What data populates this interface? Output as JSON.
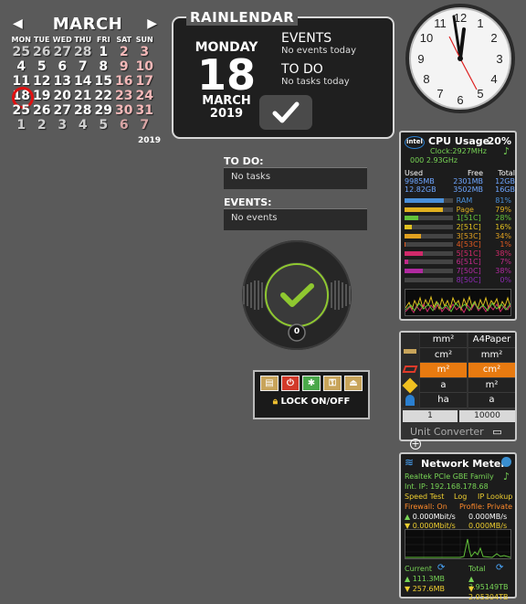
{
  "calendar": {
    "month": "MARCH",
    "year": "2019",
    "dow": [
      "MON",
      "TUE",
      "WED",
      "THU",
      "FRI",
      "SAT",
      "SUN"
    ],
    "days": [
      [
        "25",
        "dim"
      ],
      [
        "26",
        "dim"
      ],
      [
        "27",
        "dim"
      ],
      [
        "28",
        "dim"
      ],
      [
        "1",
        ""
      ],
      [
        "2",
        "wk"
      ],
      [
        "3",
        "wk"
      ],
      [
        "4",
        ""
      ],
      [
        "5",
        ""
      ],
      [
        "6",
        ""
      ],
      [
        "7",
        ""
      ],
      [
        "8",
        ""
      ],
      [
        "9",
        "wk"
      ],
      [
        "10",
        "wk"
      ],
      [
        "11",
        ""
      ],
      [
        "12",
        ""
      ],
      [
        "13",
        ""
      ],
      [
        "14",
        ""
      ],
      [
        "15",
        ""
      ],
      [
        "16",
        "wk"
      ],
      [
        "17",
        "wk"
      ],
      [
        "18",
        "today"
      ],
      [
        "19",
        ""
      ],
      [
        "20",
        ""
      ],
      [
        "21",
        ""
      ],
      [
        "22",
        ""
      ],
      [
        "23",
        "wk"
      ],
      [
        "24",
        "wk"
      ],
      [
        "25",
        ""
      ],
      [
        "26",
        ""
      ],
      [
        "27",
        ""
      ],
      [
        "28",
        ""
      ],
      [
        "29",
        ""
      ],
      [
        "30",
        "wk"
      ],
      [
        "31",
        "wk"
      ],
      [
        "1",
        "dim"
      ],
      [
        "2",
        "dim"
      ],
      [
        "3",
        "dim"
      ],
      [
        "4",
        "dim"
      ],
      [
        "5",
        "dim"
      ],
      [
        "6",
        "wkdim"
      ],
      [
        "7",
        "wkdim"
      ]
    ]
  },
  "rainlendar": {
    "title": "RAINLENDAR",
    "weekday": "MONDAY",
    "day": "18",
    "month": "MARCH",
    "year": "2019",
    "events_head": "EVENTS",
    "events_text": "No events today",
    "todo_head": "TO DO",
    "todo_text": "No tasks today"
  },
  "todo_panel": {
    "heading": "TO DO:",
    "text": "No tasks"
  },
  "events_panel": {
    "heading": "EVENTS:",
    "text": "No events"
  },
  "round_widget": {
    "count": "0"
  },
  "lock_widget": {
    "label": "LOCK ON/OFF"
  },
  "cpu": {
    "title": "CPU Usage",
    "percent": "20%",
    "clock": "Clock:2927MHz",
    "clock2": "000 2.93GHz",
    "headers": [
      "Used",
      "Free",
      "Total"
    ],
    "row1": [
      "9985MB",
      "2301MB",
      "12GB"
    ],
    "row2": [
      "12.82GB",
      "3502MB",
      "16GB"
    ],
    "bars": [
      {
        "label": "RAM",
        "value": "81%",
        "pct": 81,
        "color": "#4a8fd8"
      },
      {
        "label": "Page",
        "value": "79%",
        "pct": 79,
        "color": "#e0b020"
      },
      {
        "label": "1[51C]",
        "value": "28%",
        "pct": 28,
        "color": "#62c23a"
      },
      {
        "label": "2[51C]",
        "value": "16%",
        "pct": 16,
        "color": "#e0c020"
      },
      {
        "label": "3[53C]",
        "value": "34%",
        "pct": 34,
        "color": "#e0a020"
      },
      {
        "label": "4[53C]",
        "value": "1%",
        "pct": 1,
        "color": "#e05a20"
      },
      {
        "label": "5[51C]",
        "value": "38%",
        "pct": 38,
        "color": "#d02a6a"
      },
      {
        "label": "6[51C]",
        "value": "7%",
        "pct": 7,
        "color": "#c02a8a"
      },
      {
        "label": "7[50C]",
        "value": "38%",
        "pct": 38,
        "color": "#b02aa0"
      },
      {
        "label": "8[50C]",
        "value": "0%",
        "pct": 0,
        "color": "#8a2ab0"
      }
    ]
  },
  "unit_converter": {
    "left_col": [
      "mm²",
      "cm²",
      "m²",
      "a",
      "ha"
    ],
    "right_col": [
      "A4Paper",
      "mm²",
      "cm²",
      "m²",
      "a"
    ],
    "input_left": "1",
    "input_right": "10000",
    "footer": "Unit Converter"
  },
  "network": {
    "title": "Network Meter",
    "adapter": "Realtek PCIe GBE Family",
    "ip": "Int. IP: 192.168.178.68",
    "link1": "Speed Test",
    "link2": "Log",
    "link3": "IP Lookup",
    "firewall": "Firewall: On",
    "profile": "Profile: Private",
    "up_mbit": "0.000Mbit/s",
    "up_mb": "0.000MB/s",
    "down_mbit": "0.000Mbit/s",
    "down_mb": "0.000MB/s",
    "current_label": "Current",
    "total_label": "Total",
    "current_up": "111.3MB",
    "current_down": "257.6MB",
    "total_up": "3.95149TB",
    "total_down": "2.05304TB"
  }
}
